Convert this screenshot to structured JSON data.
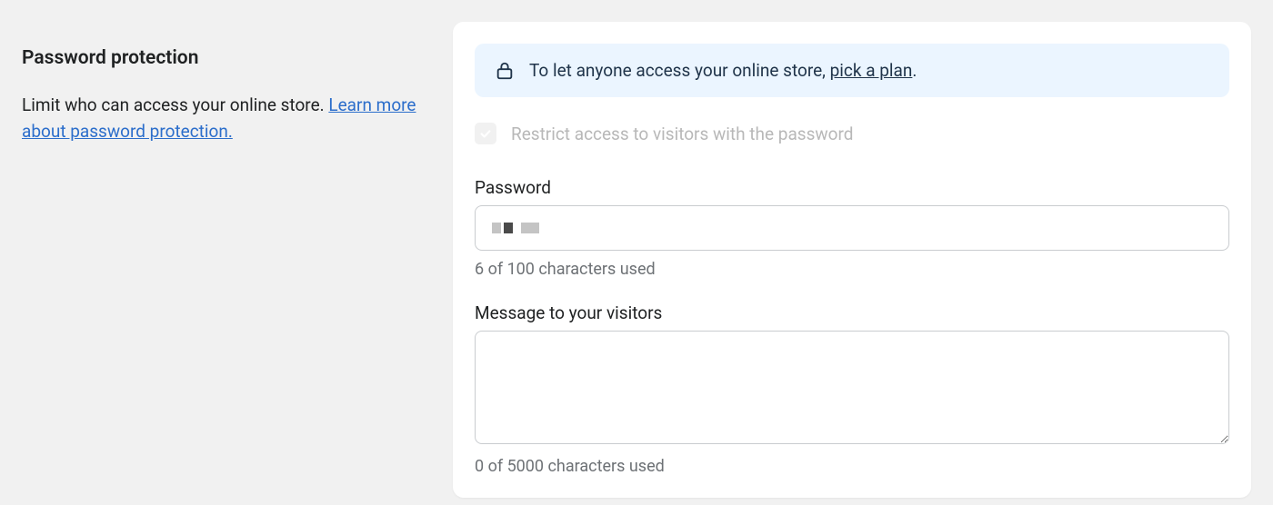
{
  "section": {
    "title": "Password protection",
    "description_text": "Limit who can access your online store. ",
    "learn_more_link_text": "Learn more about password protection."
  },
  "banner": {
    "text_prefix": "To let anyone access your online store, ",
    "link_text": "pick a plan",
    "text_suffix": "."
  },
  "checkbox": {
    "label": "Restrict access to visitors with the password",
    "checked": true,
    "disabled": true
  },
  "password_field": {
    "label": "Password",
    "value": "••••••",
    "char_count": "6 of 100 characters used"
  },
  "message_field": {
    "label": "Message to your visitors",
    "value": "",
    "char_count": "0 of 5000 characters used"
  }
}
